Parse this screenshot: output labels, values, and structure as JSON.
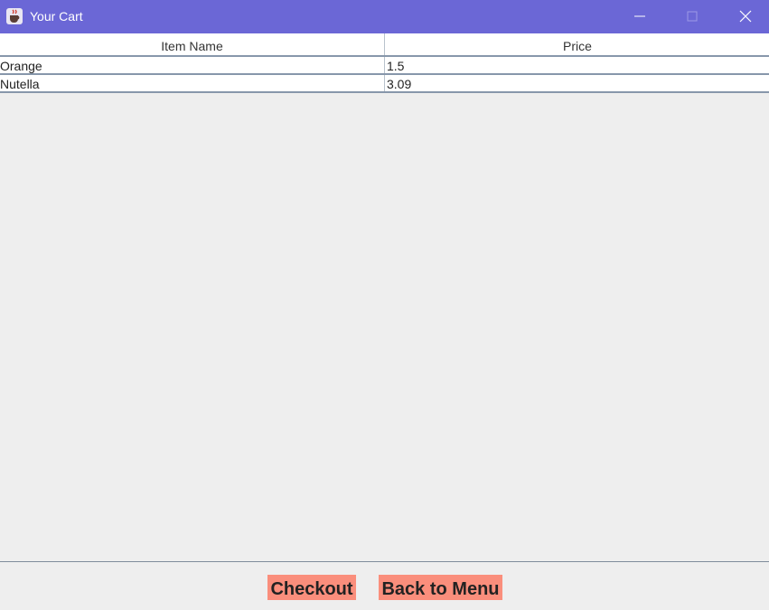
{
  "window": {
    "title": "Your Cart",
    "titlebar_color": "#6b67d6",
    "app_icon": "java-coffee-cup-icon",
    "controls": [
      "minimize-icon",
      "maximize-icon",
      "close-icon"
    ]
  },
  "table": {
    "columns": [
      "Item Name",
      "Price"
    ],
    "rows": [
      {
        "name": "Orange",
        "price": "1.5"
      },
      {
        "name": "Nutella",
        "price": "3.09"
      }
    ]
  },
  "actions": {
    "checkout_label": "Checkout",
    "back_label": "Back to Menu",
    "button_color": "#fa8e7c"
  }
}
